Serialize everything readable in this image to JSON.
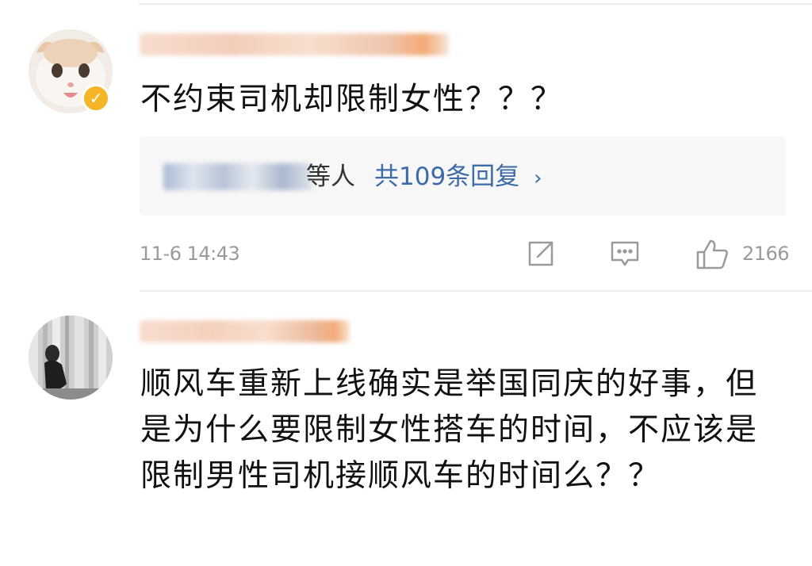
{
  "comments": [
    {
      "text": "不约束司机却限制女性？？？",
      "replies": {
        "names_suffix": "等人",
        "count_label": "共109条回复",
        "chevron": "›"
      },
      "timestamp": "11-6 14:43",
      "like_count": "2166",
      "verified": true
    },
    {
      "text": "顺风车重新上线确实是举国同庆的好事，但是为什么要限制女性搭车的时间，不应该是限制男性司机接顺风车的时间么？？"
    }
  ],
  "colors": {
    "link_blue": "#3c6ba8",
    "meta_gray": "#9a9a9a",
    "verified_badge": "#f4b526",
    "reply_box_bg": "#f7f7f7"
  },
  "icons": [
    "share-icon",
    "comment-icon",
    "like-icon",
    "verified-badge-icon"
  ]
}
